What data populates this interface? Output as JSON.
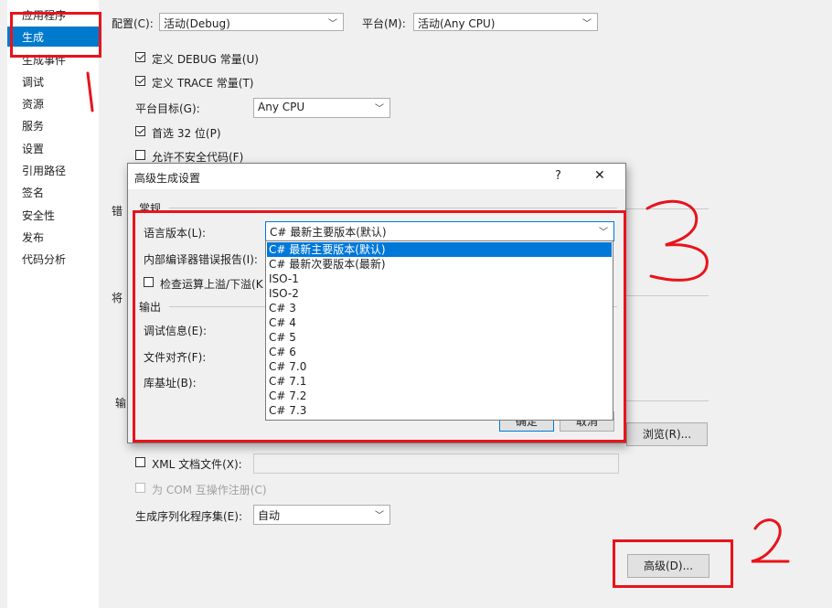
{
  "sidebar": {
    "items": [
      {
        "label": "应用程序"
      },
      {
        "label": "生成"
      },
      {
        "label": "生成事件"
      },
      {
        "label": "调试"
      },
      {
        "label": "资源"
      },
      {
        "label": "服务"
      },
      {
        "label": "设置"
      },
      {
        "label": "引用路径"
      },
      {
        "label": "签名"
      },
      {
        "label": "安全性"
      },
      {
        "label": "发布"
      },
      {
        "label": "代码分析"
      }
    ],
    "active_index": 1
  },
  "header": {
    "config_label": "配置(C):",
    "config_value": "活动(Debug)",
    "platform_label": "平台(M):",
    "platform_value": "活动(Any CPU)"
  },
  "general": {
    "define_debug": {
      "label": "定义 DEBUG 常量(U)",
      "checked": true
    },
    "define_trace": {
      "label": "定义 TRACE 常量(T)",
      "checked": true
    },
    "platform_target_label": "平台目标(G):",
    "platform_target_value": "Any CPU",
    "prefer32": {
      "label": "首选 32 位(P)",
      "checked": true
    },
    "allow_unsafe": {
      "label": "允许不安全代码(F)",
      "checked": false
    }
  },
  "background_fragments": {
    "errors": "错",
    "treat": "将",
    "output": "输"
  },
  "output_section": {
    "browse_label": "浏览(R)...",
    "xml_doc": {
      "label": "XML 文档文件(X):",
      "checked": false
    },
    "com_interop": {
      "label": "为 COM 互操作注册(C)",
      "checked": false
    },
    "serialization_label": "生成序列化程序集(E):",
    "serialization_value": "自动",
    "advanced_label": "高级(D)..."
  },
  "dialog": {
    "title": "高级生成设置",
    "help": "?",
    "close": "✕",
    "general_group": "常规",
    "lang_version_label": "语言版本(L):",
    "lang_version_value": "C# 最新主要版本(默认)",
    "compiler_report_label": "内部编译器错误报告(I):",
    "check_overflow_label": "检查运算上溢/下溢(K",
    "output_group": "输出",
    "debug_info_label": "调试信息(E):",
    "file_align_label": "文件对齐(F):",
    "base_address_label": "库基址(B):",
    "ok_label": "确定",
    "cancel_label": "取消"
  },
  "dropdown": {
    "options": [
      "C# 最新主要版本(默认)",
      "C# 最新次要版本(最新)",
      "ISO-1",
      "ISO-2",
      "C# 3",
      "C# 4",
      "C# 5",
      "C# 6",
      "C# 7.0",
      "C# 7.1",
      "C# 7.2",
      "C# 7.3"
    ],
    "selected_index": 0
  },
  "annotations": {
    "mark1": "1",
    "mark2": "2",
    "mark3": "3"
  },
  "colors": {
    "accent": "#007acc",
    "selection": "#0078d7",
    "annotation_red": "#e8131c"
  }
}
